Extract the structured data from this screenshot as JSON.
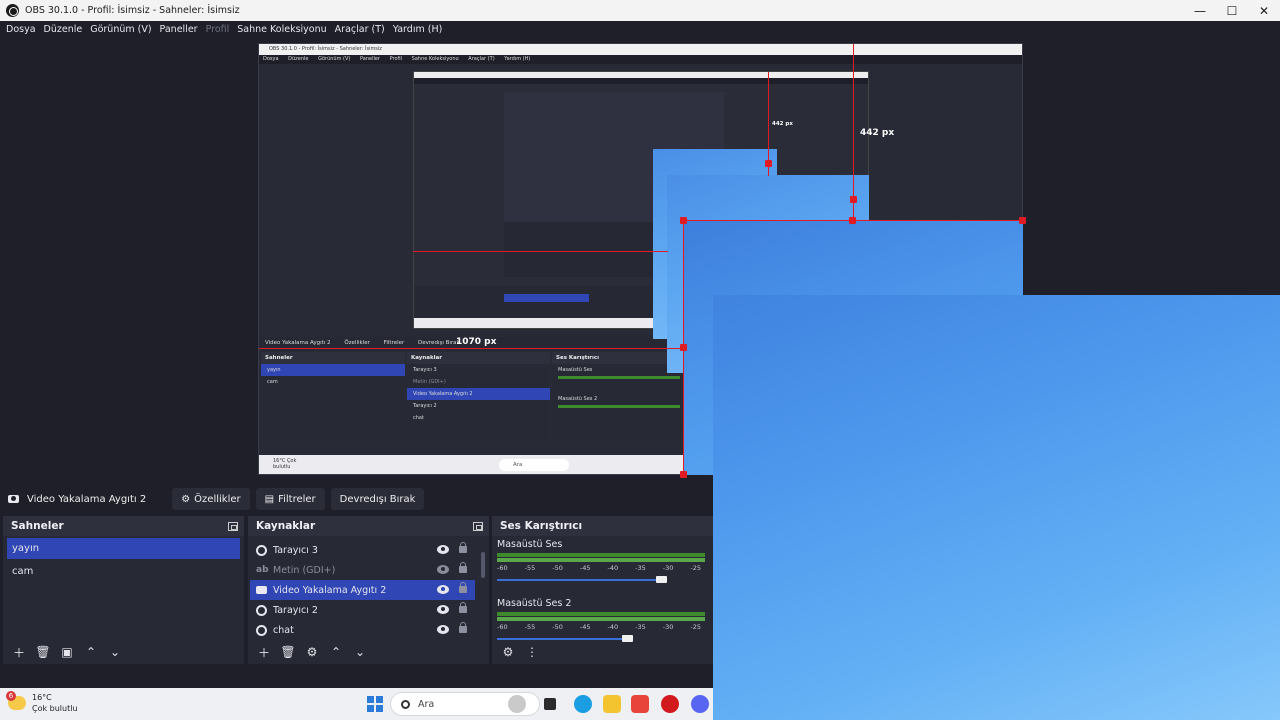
{
  "window": {
    "title": "OBS 30.1.0 - Profil: İsimsiz - Sahneler: İsimsiz",
    "minimize": "—",
    "maximize": "☐",
    "close": "✕"
  },
  "menu": {
    "items": [
      "Dosya",
      "Düzenle",
      "Görünüm (V)",
      "Paneller",
      "Profil",
      "Sahne Koleksiyonu",
      "Araçlar (T)",
      "Yardım (H)"
    ]
  },
  "preview": {
    "title": "OBS 30.1.0 - Profil: İsimsiz - Sahneler: İsimsiz",
    "menu": [
      "Dosya",
      "Düzenle",
      "Görünüm (V)",
      "Paneller",
      "Profil",
      "Sahne Koleksiyonu",
      "Araçlar (T)",
      "Yardım (H)"
    ],
    "measure_height": "442 px",
    "measure_width": "1070 px",
    "measure_small": "442 px",
    "srcbar": [
      "Video Yakalama Aygıtı 2",
      "Özellikler",
      "Filtreler",
      "Devredışı Bırak"
    ],
    "scenes_title": "Sahneler",
    "scenes": [
      "yayın",
      "cam"
    ],
    "sources_title": "Kaynaklar",
    "sources": [
      "Tarayıcı 3",
      "Metin (GDI+)",
      "Video Yakalama Aygıtı 2",
      "Tarayıcı 2",
      "chat"
    ],
    "mixer_title": "Ses Karıştırıcı",
    "mixer": [
      "Masaüstü Ses",
      "Masaüstü Ses 2"
    ],
    "weather": "16°C Çok bulutlu",
    "search": "Ara"
  },
  "source_toolbar": {
    "current_source": "Video Yakalama Aygıtı 2",
    "properties": "Özellikler",
    "filters": "Filtreler",
    "disable": "Devredışı Bırak"
  },
  "scenes": {
    "title": "Sahneler",
    "items": [
      {
        "label": "yayın",
        "selected": true
      },
      {
        "label": "cam",
        "selected": false
      }
    ]
  },
  "sources": {
    "title": "Kaynaklar",
    "items": [
      {
        "label": "Tarayıcı 3",
        "icon": "globe-icon",
        "visible": true
      },
      {
        "label": "Metin (GDI+)",
        "icon": "text-icon",
        "visible": false
      },
      {
        "label": "Video Yakalama Aygıtı 2",
        "icon": "camera-icon",
        "visible": true,
        "selected": true
      },
      {
        "label": "Tarayıcı 2",
        "icon": "globe-icon",
        "visible": true
      },
      {
        "label": "chat",
        "icon": "globe-icon",
        "visible": true
      }
    ]
  },
  "mixer": {
    "title": "Ses Karıştırıcı",
    "scale": [
      "-60",
      "-55",
      "-50",
      "-45",
      "-40",
      "-35",
      "-30",
      "-25"
    ],
    "tracks": [
      {
        "name": "Masaüstü Ses",
        "volume": 0.82
      },
      {
        "name": "Masaüstü Ses 2",
        "volume": 0.65
      }
    ]
  },
  "taskbar": {
    "weather_badge": "6",
    "temperature": "16°C",
    "condition": "Çok bulutlu",
    "search_placeholder": "Ara"
  }
}
